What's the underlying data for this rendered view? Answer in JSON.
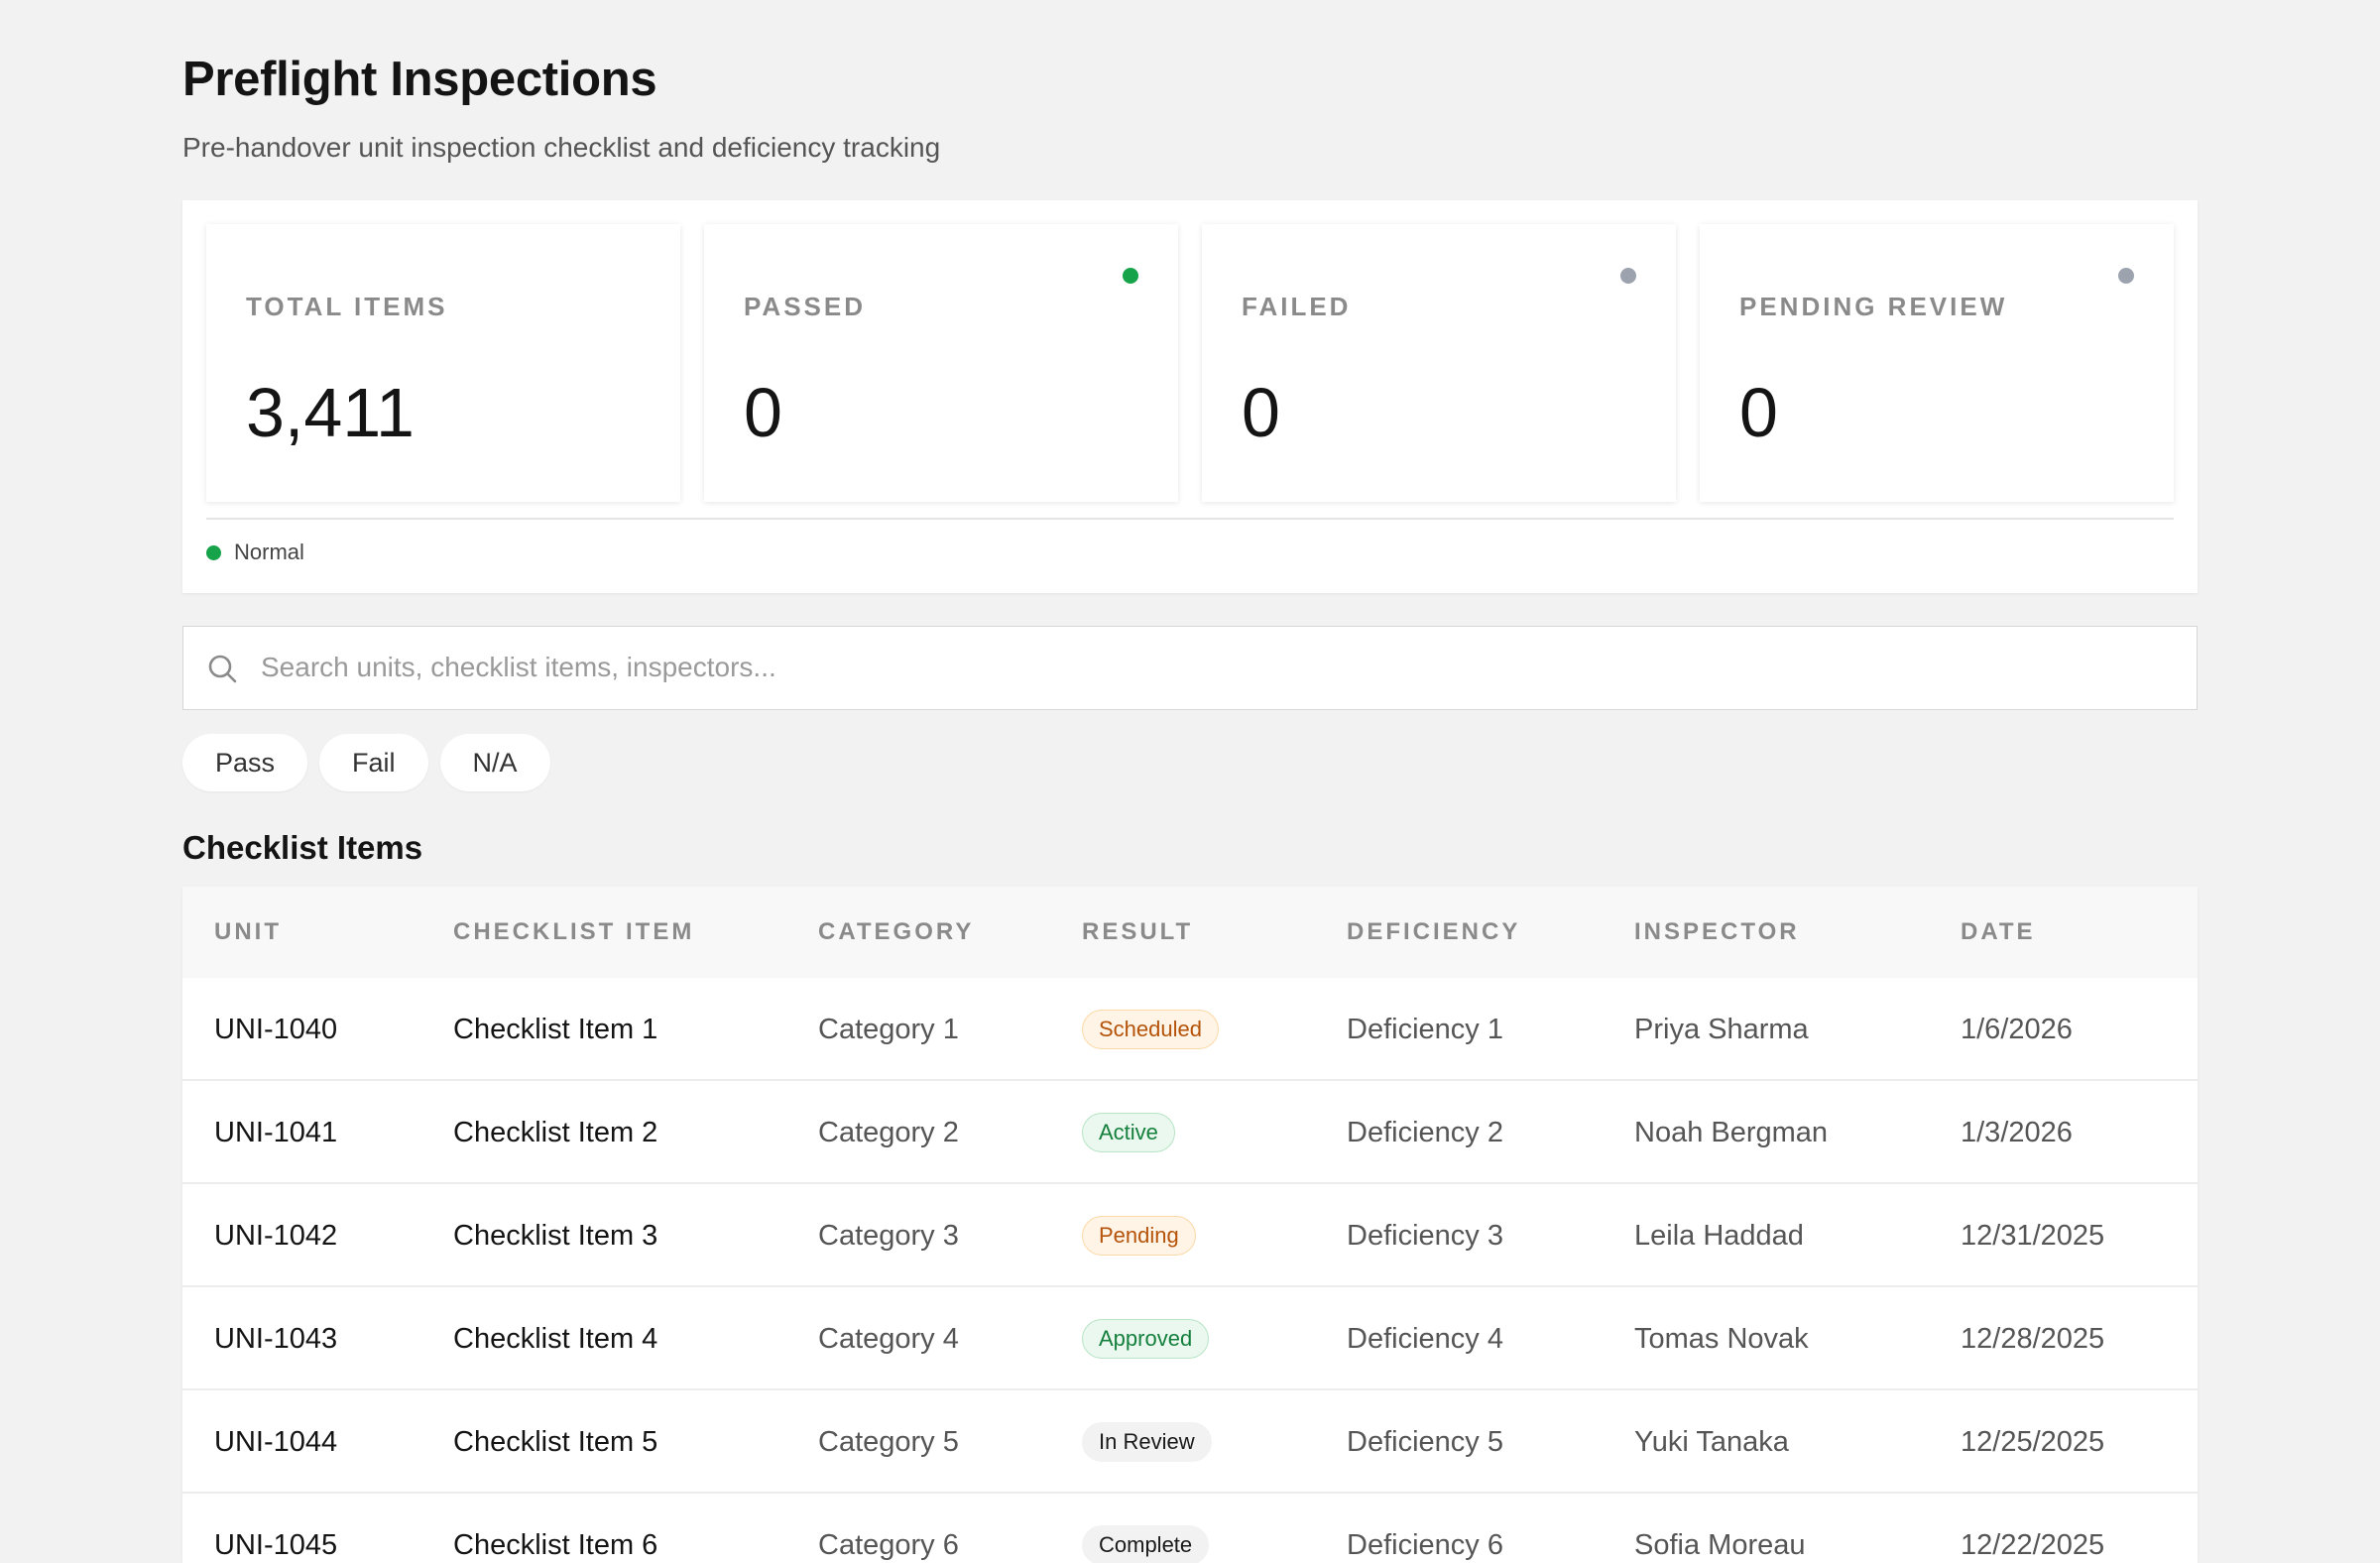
{
  "header": {
    "title": "Preflight Inspections",
    "subtitle": "Pre-handover unit inspection checklist and deficiency tracking"
  },
  "stats": [
    {
      "label": "TOTAL ITEMS",
      "value": "3,411",
      "dot": null
    },
    {
      "label": "PASSED",
      "value": "0",
      "dot": "#16a34a"
    },
    {
      "label": "FAILED",
      "value": "0",
      "dot": "#9ca3af"
    },
    {
      "label": "PENDING REVIEW",
      "value": "0",
      "dot": "#9ca3af"
    }
  ],
  "legend": {
    "label": "Normal",
    "color": "#16a34a"
  },
  "search": {
    "placeholder": "Search units, checklist items, inspectors..."
  },
  "filters": [
    "Pass",
    "Fail",
    "N/A"
  ],
  "section_title": "Checklist Items",
  "table": {
    "columns": [
      "UNIT",
      "CHECKLIST ITEM",
      "CATEGORY",
      "RESULT",
      "DEFICIENCY",
      "INSPECTOR",
      "DATE"
    ],
    "rows": [
      {
        "unit": "UNI-1040",
        "item": "Checklist Item 1",
        "category": "Category 1",
        "result": "Scheduled",
        "result_style": "orange",
        "deficiency": "Deficiency 1",
        "inspector": "Priya Sharma",
        "date": "1/6/2026"
      },
      {
        "unit": "UNI-1041",
        "item": "Checklist Item 2",
        "category": "Category 2",
        "result": "Active",
        "result_style": "green",
        "deficiency": "Deficiency 2",
        "inspector": "Noah Bergman",
        "date": "1/3/2026"
      },
      {
        "unit": "UNI-1042",
        "item": "Checklist Item 3",
        "category": "Category 3",
        "result": "Pending",
        "result_style": "orange",
        "deficiency": "Deficiency 3",
        "inspector": "Leila Haddad",
        "date": "12/31/2025"
      },
      {
        "unit": "UNI-1043",
        "item": "Checklist Item 4",
        "category": "Category 4",
        "result": "Approved",
        "result_style": "green",
        "deficiency": "Deficiency 4",
        "inspector": "Tomas Novak",
        "date": "12/28/2025"
      },
      {
        "unit": "UNI-1044",
        "item": "Checklist Item 5",
        "category": "Category 5",
        "result": "In Review",
        "result_style": "gray",
        "deficiency": "Deficiency 5",
        "inspector": "Yuki Tanaka",
        "date": "12/25/2025"
      },
      {
        "unit": "UNI-1045",
        "item": "Checklist Item 6",
        "category": "Category 6",
        "result": "Complete",
        "result_style": "gray",
        "deficiency": "Deficiency 6",
        "inspector": "Sofia Moreau",
        "date": "12/22/2025"
      }
    ]
  }
}
